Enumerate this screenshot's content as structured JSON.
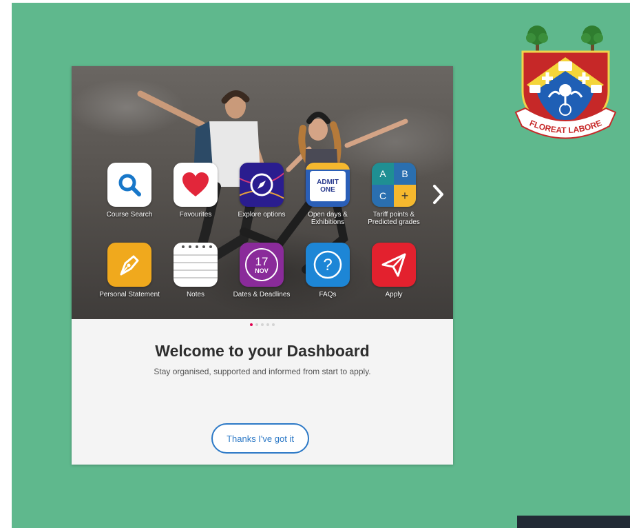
{
  "tiles": [
    {
      "label": "Course Search",
      "icon": "search-icon",
      "bg": "#ffffff"
    },
    {
      "label": "Favourites",
      "icon": "heart-icon",
      "bg": "#ffffff"
    },
    {
      "label": "Explore options",
      "icon": "compass-icon",
      "bg": "#2a1d8f"
    },
    {
      "label": "Open days & Exhibitions",
      "icon": "ticket-icon",
      "bg": "#2a5fb8",
      "ticket_text": "ADMIT ONE"
    },
    {
      "label": "Tariff points & Predicted grades",
      "icon": "grade-grid-icon",
      "bg": "#1f8f93",
      "cells": [
        "A",
        "B",
        "C",
        "+"
      ]
    },
    {
      "label": "Personal Statement",
      "icon": "pen-nib-icon",
      "bg": "#f0a91d"
    },
    {
      "label": "Notes",
      "icon": "notepad-icon",
      "bg": "#ffffff"
    },
    {
      "label": "Dates & Deadlines",
      "icon": "calendar-icon",
      "bg": "#8a2b9a",
      "day": "17",
      "month": "NOV"
    },
    {
      "label": "FAQs",
      "icon": "question-icon",
      "bg": "#1d86d6"
    },
    {
      "label": "Apply",
      "icon": "paper-plane-icon",
      "bg": "#e3212e"
    }
  ],
  "pagination": {
    "total": 5,
    "active": 0
  },
  "welcome": {
    "title": "Welcome to your Dashboard",
    "subtitle": "Stay organised, supported and informed from start to apply."
  },
  "cta": {
    "label": "Thanks I've got it"
  },
  "crest": {
    "motto": "FLOREAT LABORE"
  },
  "colors": {
    "slide_bg": "#5fb88d",
    "accent": "#2b78c6",
    "active_dot": "#e0004f"
  }
}
